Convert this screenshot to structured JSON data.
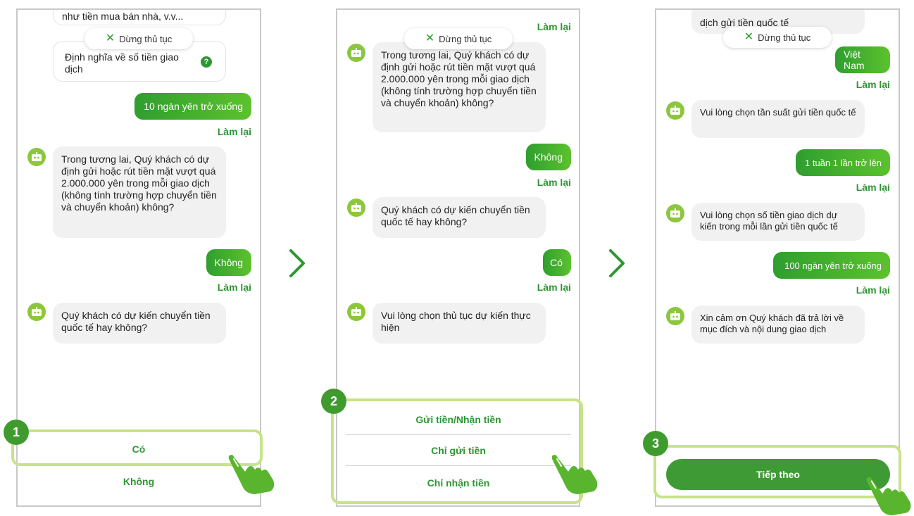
{
  "stop_label": "Dừng thủ tục",
  "redo_label": "Làm lại",
  "colors": {
    "accent": "#2e9632",
    "bubble_user_start": "#2f9e2f",
    "bubble_user_end": "#5cc22d",
    "bot_avatar": "#8cc63f",
    "highlight": "#c7e38a",
    "badge": "#3f9b2e"
  },
  "icons": {
    "stop": "close-icon",
    "bot": "bot-avatar-icon",
    "help": "question-icon",
    "step": "chevron-right-icon",
    "hand": "tap-hand-icon"
  },
  "screen1": {
    "badge": "1",
    "clipped_text": "như tiền mua bán nhà, v.v...",
    "definition_text": "Định nghĩa về số tiền giao dịch",
    "help_icon_label": "?",
    "user_answer_1": "10 ngàn yên trở xuống",
    "bot_q1": "Trong tương lai, Quý khách có dự định gửi hoặc rút tiền mặt vượt quá 2.000.000 yên trong mỗi giao dịch (không tính trường hợp chuyển tiền và chuyển khoản) không?",
    "user_answer_2": "Không",
    "bot_q2": "Quý khách có dự kiến chuyển tiền quốc tế hay không?",
    "options": [
      "Có",
      "Không"
    ]
  },
  "screen2": {
    "badge": "2",
    "bot_q1": "Trong tương lai, Quý khách có dự định gửi hoặc rút tiền mặt vượt quá 2.000.000 yên trong mỗi giao dịch (không tính trường hợp chuyển tiền và chuyển khoản) không?",
    "user_answer_1": "Không",
    "bot_q2": "Quý khách có dự kiến chuyển tiền quốc tế hay không?",
    "user_answer_2": "Có",
    "bot_q3": "Vui lòng chọn thủ tục dự kiến thực hiện",
    "options": [
      "Gửi tiền/Nhận tiền",
      "Chỉ gửi tiền",
      "Chỉ nhận tiền"
    ]
  },
  "screen3": {
    "badge": "3",
    "clipped_text": "dịch gửi tiền quốc tế",
    "user_answer_1": "Việt Nam",
    "bot_q1": "Vui lòng chọn tần suất gửi tiền quốc tế",
    "user_answer_2": "1 tuần 1 lần trở lên",
    "bot_q2": "Vui lòng chọn số tiền giao dịch dự kiến trong mỗi lần gửi tiền quốc tế",
    "user_answer_3": "100 ngàn yên trở xuống",
    "bot_q3": "Xin cảm ơn Quý khách đã trả lời về mục đích và nội dung giao dịch",
    "next_label": "Tiếp theo"
  }
}
